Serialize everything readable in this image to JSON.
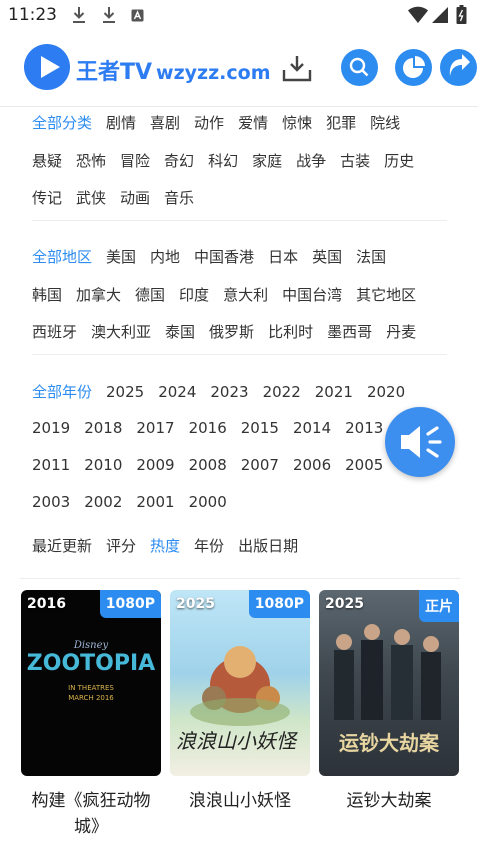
{
  "status": {
    "time": "11:23"
  },
  "header": {
    "brand": "王者TV",
    "url": "wzyzz.com"
  },
  "filters": {
    "genre": {
      "rows": [
        [
          {
            "label": "全部分类",
            "active": true
          },
          {
            "label": "剧情"
          },
          {
            "label": "喜剧"
          },
          {
            "label": "动作"
          },
          {
            "label": "爱情"
          },
          {
            "label": "惊悚"
          },
          {
            "label": "犯罪"
          },
          {
            "label": "院线"
          }
        ],
        [
          {
            "label": "悬疑"
          },
          {
            "label": "恐怖"
          },
          {
            "label": "冒险"
          },
          {
            "label": "奇幻"
          },
          {
            "label": "科幻"
          },
          {
            "label": "家庭"
          },
          {
            "label": "战争"
          },
          {
            "label": "古装"
          },
          {
            "label": "历史"
          }
        ],
        [
          {
            "label": "传记"
          },
          {
            "label": "武侠"
          },
          {
            "label": "动画"
          },
          {
            "label": "音乐"
          }
        ]
      ]
    },
    "region": {
      "rows": [
        [
          {
            "label": "全部地区",
            "active": true
          },
          {
            "label": "美国"
          },
          {
            "label": "内地"
          },
          {
            "label": "中国香港"
          },
          {
            "label": "日本"
          },
          {
            "label": "英国"
          },
          {
            "label": "法国"
          }
        ],
        [
          {
            "label": "韩国"
          },
          {
            "label": "加拿大"
          },
          {
            "label": "德国"
          },
          {
            "label": "印度"
          },
          {
            "label": "意大利"
          },
          {
            "label": "中国台湾"
          },
          {
            "label": "其它地区"
          }
        ],
        [
          {
            "label": "西班牙"
          },
          {
            "label": "澳大利亚"
          },
          {
            "label": "泰国"
          },
          {
            "label": "俄罗斯"
          },
          {
            "label": "比利时"
          },
          {
            "label": "墨西哥"
          },
          {
            "label": "丹麦"
          }
        ]
      ]
    },
    "year": {
      "rows": [
        [
          {
            "label": "全部年份",
            "active": true
          },
          {
            "label": "2025"
          },
          {
            "label": "2024"
          },
          {
            "label": "2023"
          },
          {
            "label": "2022"
          },
          {
            "label": "2021"
          },
          {
            "label": "2020"
          }
        ],
        [
          {
            "label": "2019"
          },
          {
            "label": "2018"
          },
          {
            "label": "2017"
          },
          {
            "label": "2016"
          },
          {
            "label": "2015"
          },
          {
            "label": "2014"
          },
          {
            "label": "2013"
          }
        ],
        [
          {
            "label": "2011"
          },
          {
            "label": "2010"
          },
          {
            "label": "2009"
          },
          {
            "label": "2008"
          },
          {
            "label": "2007"
          },
          {
            "label": "2006"
          },
          {
            "label": "2005"
          },
          {
            "label": "2"
          }
        ],
        [
          {
            "label": "2003"
          },
          {
            "label": "2002"
          },
          {
            "label": "2001"
          },
          {
            "label": "2000"
          }
        ]
      ]
    },
    "sort": {
      "rows": [
        [
          {
            "label": "最近更新"
          },
          {
            "label": "评分"
          },
          {
            "label": "热度",
            "active": true
          },
          {
            "label": "年份"
          },
          {
            "label": "出版日期"
          }
        ]
      ]
    }
  },
  "cards": [
    {
      "year": "2016",
      "quality": "1080P",
      "title": "构建《疯狂动物城》",
      "poster_text": "ZOOTOPIA",
      "poster_sub": "IN THEATRES MARCH 2016",
      "poster_brand": "Disney"
    },
    {
      "year": "2025",
      "quality": "1080P",
      "title": "浪浪山小妖怪",
      "poster_text": "浪浪山小妖怪"
    },
    {
      "year": "2025",
      "quality": "正片",
      "title": "运钞大劫案",
      "poster_text": "运钞大劫案"
    }
  ],
  "colors": {
    "accent": "#2d8cf0",
    "brand": "#2d7cf1"
  }
}
